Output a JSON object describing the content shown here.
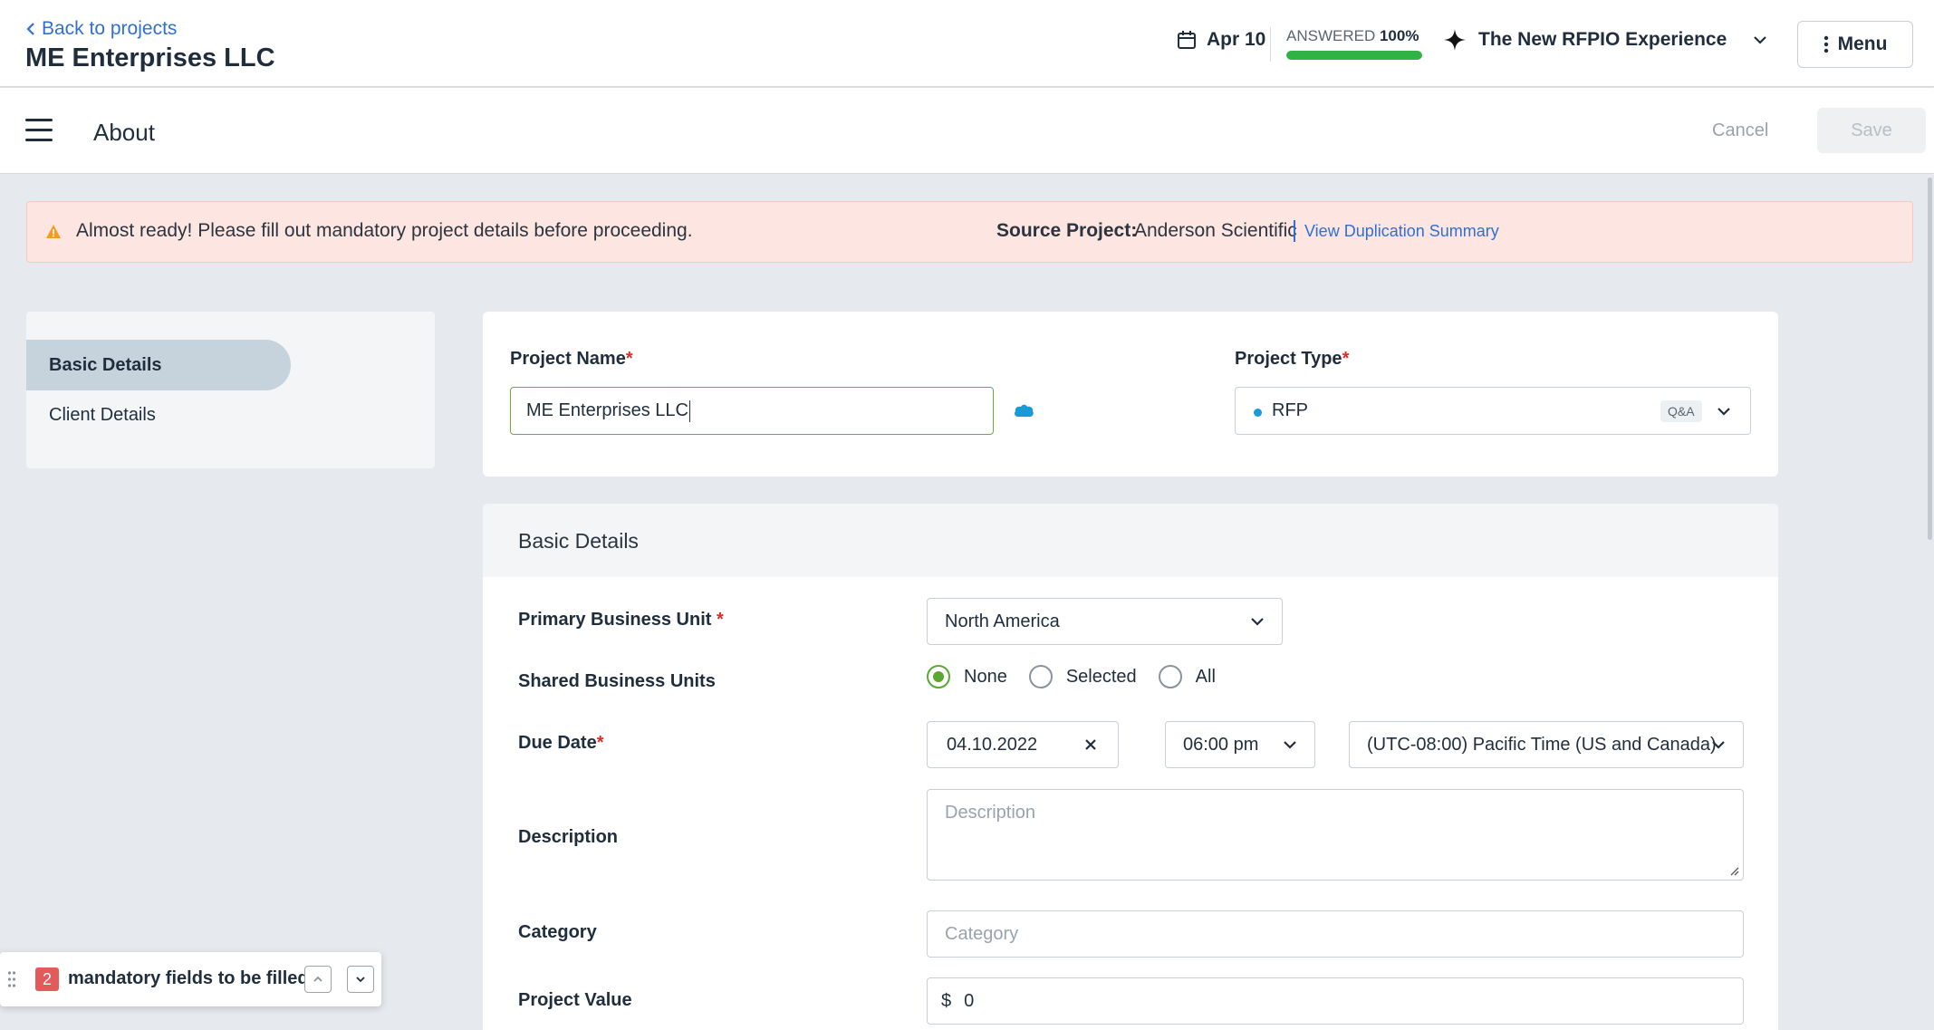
{
  "header": {
    "back_label": "Back to projects",
    "project_title": "ME Enterprises LLC",
    "due_label": "Apr 10",
    "answered_label": "ANSWERED",
    "answered_pct": "100%",
    "answered_fraction": 1.0,
    "experience_label": "The New RFPIO Experience",
    "menu_label": "Menu"
  },
  "subbar": {
    "title": "About",
    "cancel_label": "Cancel",
    "save_label": "Save"
  },
  "alert": {
    "message": "Almost ready! Please fill out mandatory project details before proceeding.",
    "source_label": "Source Project:",
    "source_value": "Anderson Scientific",
    "link_label": "View Duplication Summary"
  },
  "leftnav": {
    "items": [
      {
        "label": "Basic Details",
        "active": true
      },
      {
        "label": "Client Details",
        "active": false
      }
    ]
  },
  "project": {
    "name_label": "Project Name",
    "name_value": "ME Enterprises LLC",
    "type_label": "Project Type",
    "type_value": "RFP",
    "type_badge": "Q&A",
    "required_mark": "*"
  },
  "basic": {
    "title": "Basic Details",
    "primary_bu_label": "Primary Business Unit",
    "primary_bu_value": "North America",
    "shared_bu_label": "Shared Business Units",
    "shared_options": [
      "None",
      "Selected",
      "All"
    ],
    "shared_selected": "None",
    "due_label": "Due Date",
    "due_date": "04.10.2022",
    "due_time": "06:00 pm",
    "timezone": "(UTC-08:00) Pacific Time (US and Canada)",
    "description_label": "Description",
    "description_placeholder": "Description",
    "category_label": "Category",
    "category_placeholder": "Category",
    "value_label": "Project Value",
    "value_currency": "$",
    "value_amount": "0"
  },
  "mandatory": {
    "count": "2",
    "text": "mandatory fields to be filled"
  },
  "colors": {
    "accent_link": "#2f6fd6",
    "progress_green": "#2fb344",
    "radio_green": "#5aa832",
    "alert_bg": "#fde6e1",
    "required_red": "#e02a2a"
  }
}
